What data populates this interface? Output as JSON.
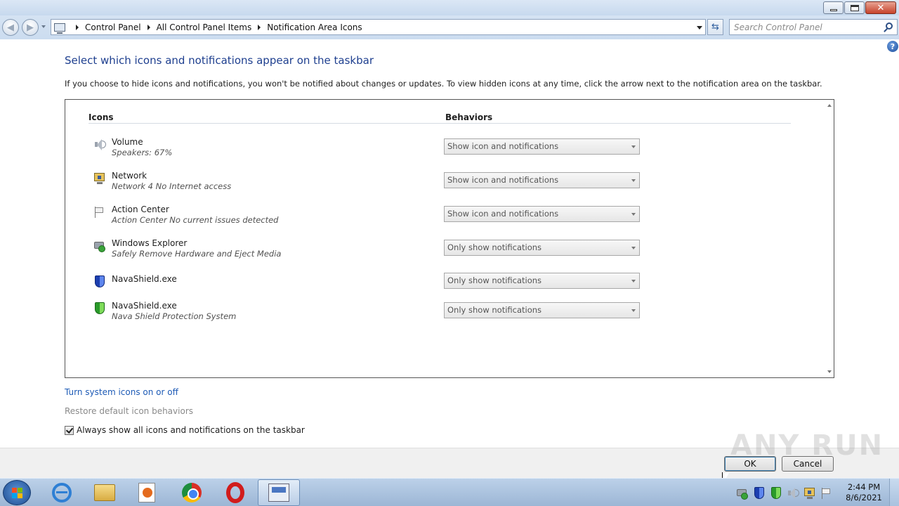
{
  "window": {
    "buttons": [
      "minimize-button",
      "maximize-button",
      "close-button"
    ]
  },
  "address": {
    "crumbs": [
      "Control Panel",
      "All Control Panel Items",
      "Notification Area Icons"
    ]
  },
  "search": {
    "placeholder": "Search Control Panel"
  },
  "page": {
    "title": "Select which icons and notifications appear on the taskbar",
    "description": "If you choose to hide icons and notifications, you won't be notified about changes or updates. To view hidden icons at any time, click the arrow next to the notification area on the taskbar."
  },
  "table": {
    "col_icons": "Icons",
    "col_behaviors": "Behaviors",
    "rows": [
      {
        "icon": "speaker-icon",
        "name": "Volume",
        "sub": "Speakers: 67%",
        "behavior": "Show icon and notifications"
      },
      {
        "icon": "network-icon",
        "name": "Network",
        "sub": "Network  4 No Internet access",
        "behavior": "Show icon and notifications"
      },
      {
        "icon": "flag-icon",
        "name": "Action Center",
        "sub": "Action Center  No current issues detected",
        "behavior": "Show icon and notifications"
      },
      {
        "icon": "safely-remove-icon",
        "name": "Windows Explorer",
        "sub": "Safely Remove Hardware and Eject Media",
        "behavior": "Only show notifications"
      },
      {
        "icon": "shield-blue-icon",
        "name": "NavaShield.exe",
        "sub": "",
        "behavior": "Only show notifications"
      },
      {
        "icon": "shield-green-icon",
        "name": "NavaShield.exe",
        "sub": "Nava Shield Protection System",
        "behavior": "Only show notifications"
      }
    ]
  },
  "links": {
    "system_icons": "Turn system icons on or off",
    "restore_defaults": "Restore default icon behaviors"
  },
  "checkbox": {
    "label": "Always show all icons and notifications on the taskbar",
    "checked": true
  },
  "footer": {
    "ok": "OK",
    "cancel": "Cancel",
    "watermark": "ANY RUN"
  },
  "taskbar": {
    "apps": [
      "internet-explorer-icon",
      "explorer-folder-icon",
      "media-player-icon",
      "chrome-icon",
      "opera-icon",
      "control-panel-icon"
    ],
    "active_app": "control-panel-icon",
    "tray_icons": [
      "safely-remove-icon",
      "shield-blue-icon",
      "shield-green-icon",
      "speaker-icon",
      "network-icon",
      "flag-icon"
    ],
    "time": "2:44 PM",
    "date": "8/6/2021"
  }
}
